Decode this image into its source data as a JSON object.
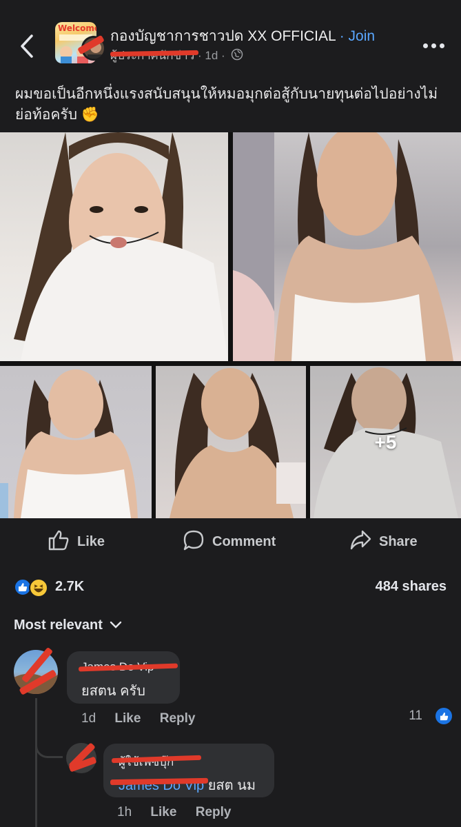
{
  "header": {
    "group_name": "กองบัญชาการชาวปด XX OFFICIAL",
    "join_label": "· Join",
    "author_redacted": "ผู้ประกาศนักข่าว",
    "time": "· 1d ·",
    "thumb_text": "Welcome"
  },
  "post": {
    "text": "ผมขอเป็นอีกหนึ่งแรงสนับสนุนให้หมอมุกต่อสู้กับนายทุนต่อไปอย่างไม่ย่อท้อครับ ✊",
    "more_photos_label": "+5"
  },
  "actions": {
    "like_label": "Like",
    "comment_label": "Comment",
    "share_label": "Share"
  },
  "stats": {
    "reaction_count": "2.7K",
    "shares": "484 shares"
  },
  "comments": {
    "sort_label": "Most relevant",
    "items": [
      {
        "name": "James Do Vip",
        "text": "ยสตน ครับ",
        "time": "1d",
        "like": "Like",
        "reply": "Reply",
        "like_count": "11"
      },
      {
        "name": "ผู้ใช้เฟซบุ๊ก",
        "mention": "James Do Vip",
        "text": " ยสต นม",
        "time": "1h",
        "like": "Like",
        "reply": "Reply"
      }
    ]
  },
  "colors": {
    "background": "#1c1c1e",
    "accent_blue": "#5aa7ff",
    "reaction_like": "#1b74e4",
    "redaction_red": "#e03a2a"
  },
  "icons": [
    "back-chevron-icon",
    "globe-icon",
    "more-dots-icon",
    "like-thumb-icon",
    "comment-bubble-icon",
    "share-arrow-icon",
    "chevron-down-icon"
  ]
}
